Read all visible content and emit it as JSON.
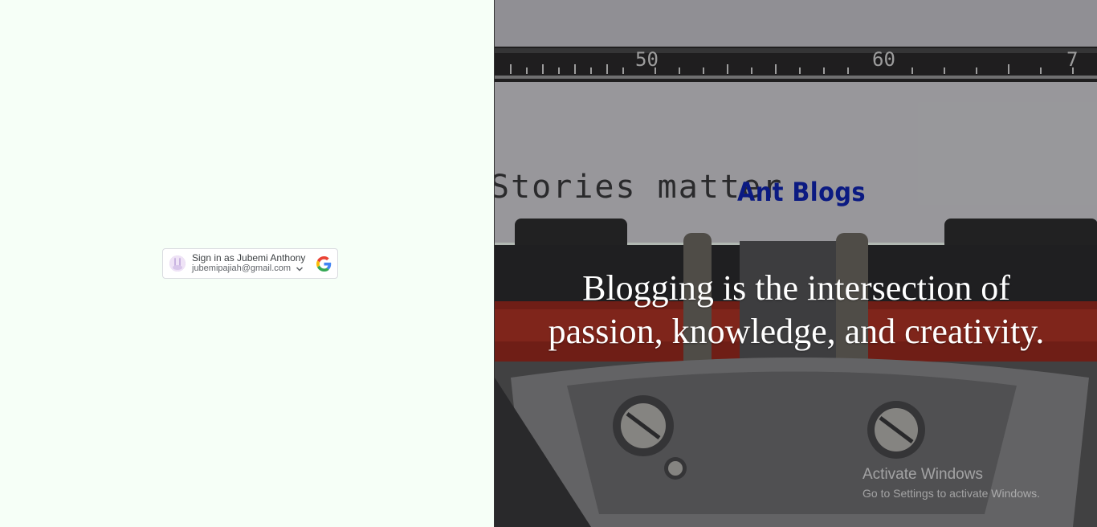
{
  "google_signin": {
    "label": "Sign in as Jubemi Anthony",
    "email": "jubemipajiah@gmail.com"
  },
  "hero": {
    "typed_text": "Stories matter",
    "ruler_numbers": [
      "50",
      "60",
      "7"
    ],
    "site_title": "Ant Blogs",
    "tagline_line1": "Blogging is the intersection of",
    "tagline_line2": "passion, knowledge, and creativity."
  },
  "windows_watermark": {
    "title": "Activate Windows",
    "subtitle": "Go to Settings to activate Windows."
  },
  "colors": {
    "page_bg": "#f6fff7",
    "site_title": "#0b1a82",
    "tagline": "#ffffff"
  }
}
